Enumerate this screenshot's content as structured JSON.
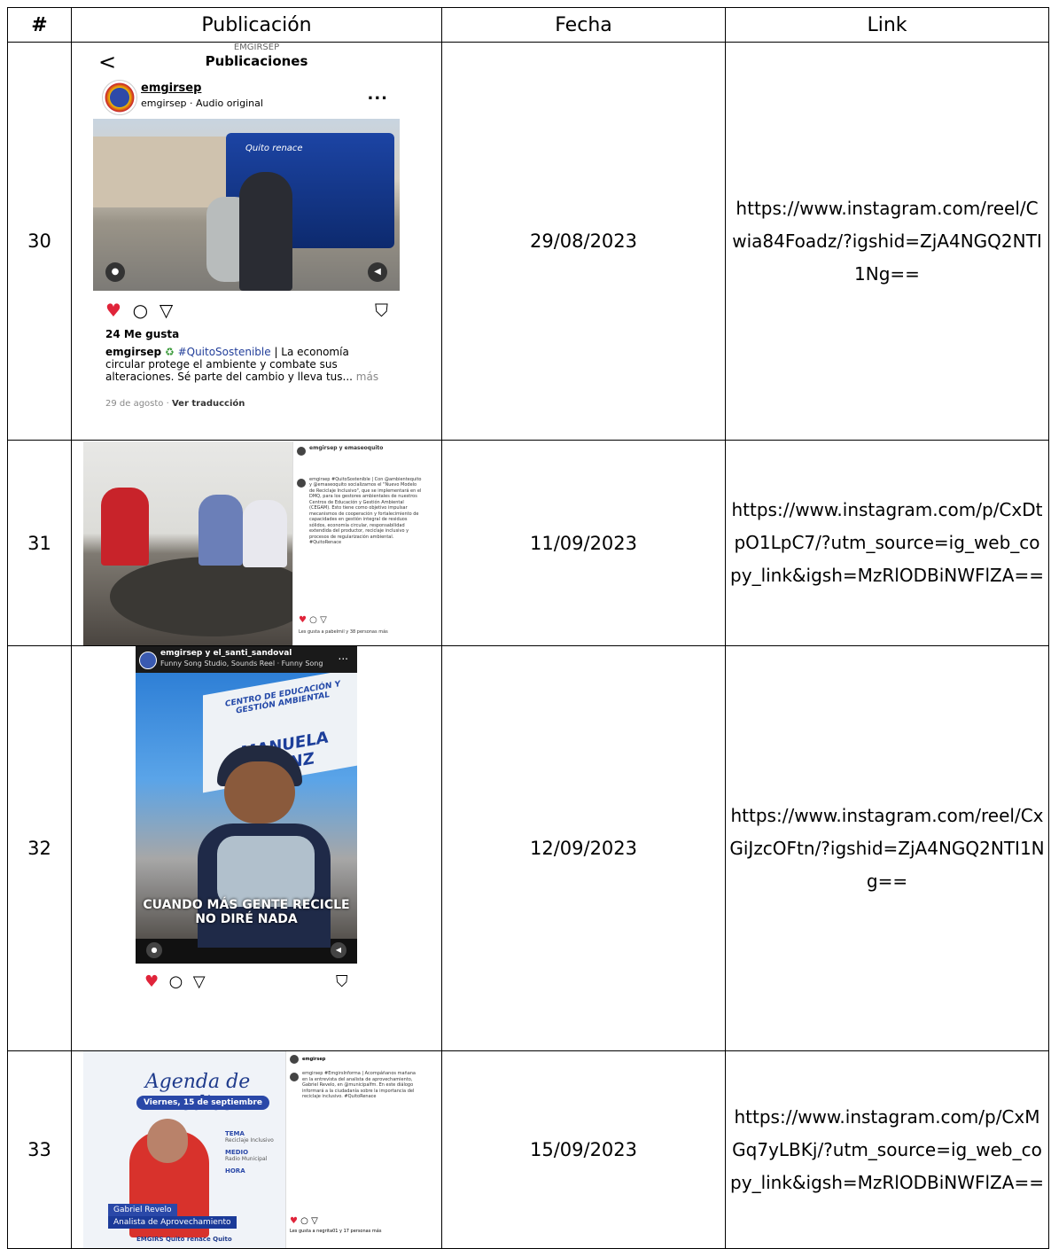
{
  "headers": [
    "#",
    "Publicación",
    "Fecha",
    "Link"
  ],
  "rows": [
    {
      "num": "30",
      "date": "29/08/2023",
      "link": "https://www.instagram.com/reel/Cwia84Foadz/?igshid=ZjA4NGQ2NTI1Ng==",
      "post": {
        "back": "<",
        "account_label": "EMGIRSEP",
        "title": "Publicaciones",
        "username": "emgirsep",
        "subtitle": "emgirsep · Audio original",
        "more": "...",
        "bus_text": "Quito renace",
        "likes": "24 Me gusta",
        "caption_user": "emgirsep",
        "caption_hashtag": "#QuitoSostenible",
        "caption_text": " | La economía circular protege el ambiente y combate sus alteraciones. Sé parte del cambio y lleva tus...",
        "caption_more": " más",
        "date_text": "29 de agosto · ",
        "translate": "Ver traducción"
      }
    },
    {
      "num": "31",
      "date": "11/09/2023",
      "link": "https://www.instagram.com/p/CxDtpO1LpC7/?utm_source=ig_web_copy_link&igsh=MzRlODBiNWFlZA==",
      "post": {
        "side_header": "emgirsep y emaseoquito",
        "side_text": "emgirsep #QuitoSostenible | Con @ambientequito y @emaseoquito socializamos el \"Nuevo Modelo de Reciclaje Inclusivo\", que se implementará en el DMQ, para los gestores ambientales de nuestros Centros de Educación y Gestión Ambiental (CEGAM). Esto tiene como objetivo impulsar mecanismos de cooperación y fortalecimiento de capacidades en gestión integral de residuos sólidos, economía circular, responsabilidad extendida del productor, reciclaje inclusivo y procesos de regularización ambiental. #QuitoRenace",
        "likes_text": "Les gusta a pabelmil y 38 personas más"
      }
    },
    {
      "num": "32",
      "date": "12/09/2023",
      "link": "https://www.instagram.com/reel/CxGiJzcOFtn/?igshid=ZjA4NGQ2NTI1Ng==",
      "post": {
        "username": "emgirsep y el_santi_sandoval",
        "song": "Funny Song Studio, Sounds Reel · Funny Song",
        "more": "...",
        "sign_top": "CENTRO DE EDUCACIÓN Y GESTIÓN AMBIENTAL",
        "sign_name": "MANUELA SÁENZ",
        "overlay": "CUANDO MÁS GENTE RECICLE NO DIRÉ NADA"
      }
    },
    {
      "num": "33",
      "date": "15/09/2023",
      "link": "https://www.instagram.com/p/CxMGq7yLBKj/?utm_source=ig_web_copy_link&igsh=MzRlODBiNWFlZA==",
      "post": {
        "agenda": "Agenda de medios",
        "day": "Viernes, 15 de septiembre",
        "tema_k": "TEMA",
        "tema_v": "Reciclaje Inclusivo",
        "medio_k": "MEDIO",
        "medio_v": "Radio Municipal",
        "hora_k": "HORA",
        "name": "Gabriel Revelo",
        "role": "Analista de Aprovechamiento",
        "logos": "EMGIRS   Quito renace   Quito",
        "side_header": "emgirsep",
        "side_text": "emgirsep #EmgirsInforma | Acompáñanos mañana en la entrevista del analista de aprovechamiento, Gabriel Revelo, en @municipalfm. En este diálogo informará a la ciudadanía sobre la importancia del reciclaje inclusivo. #QuitoRenace",
        "likes_text": "Les gusta a negrita01 y 17 personas más"
      }
    }
  ]
}
